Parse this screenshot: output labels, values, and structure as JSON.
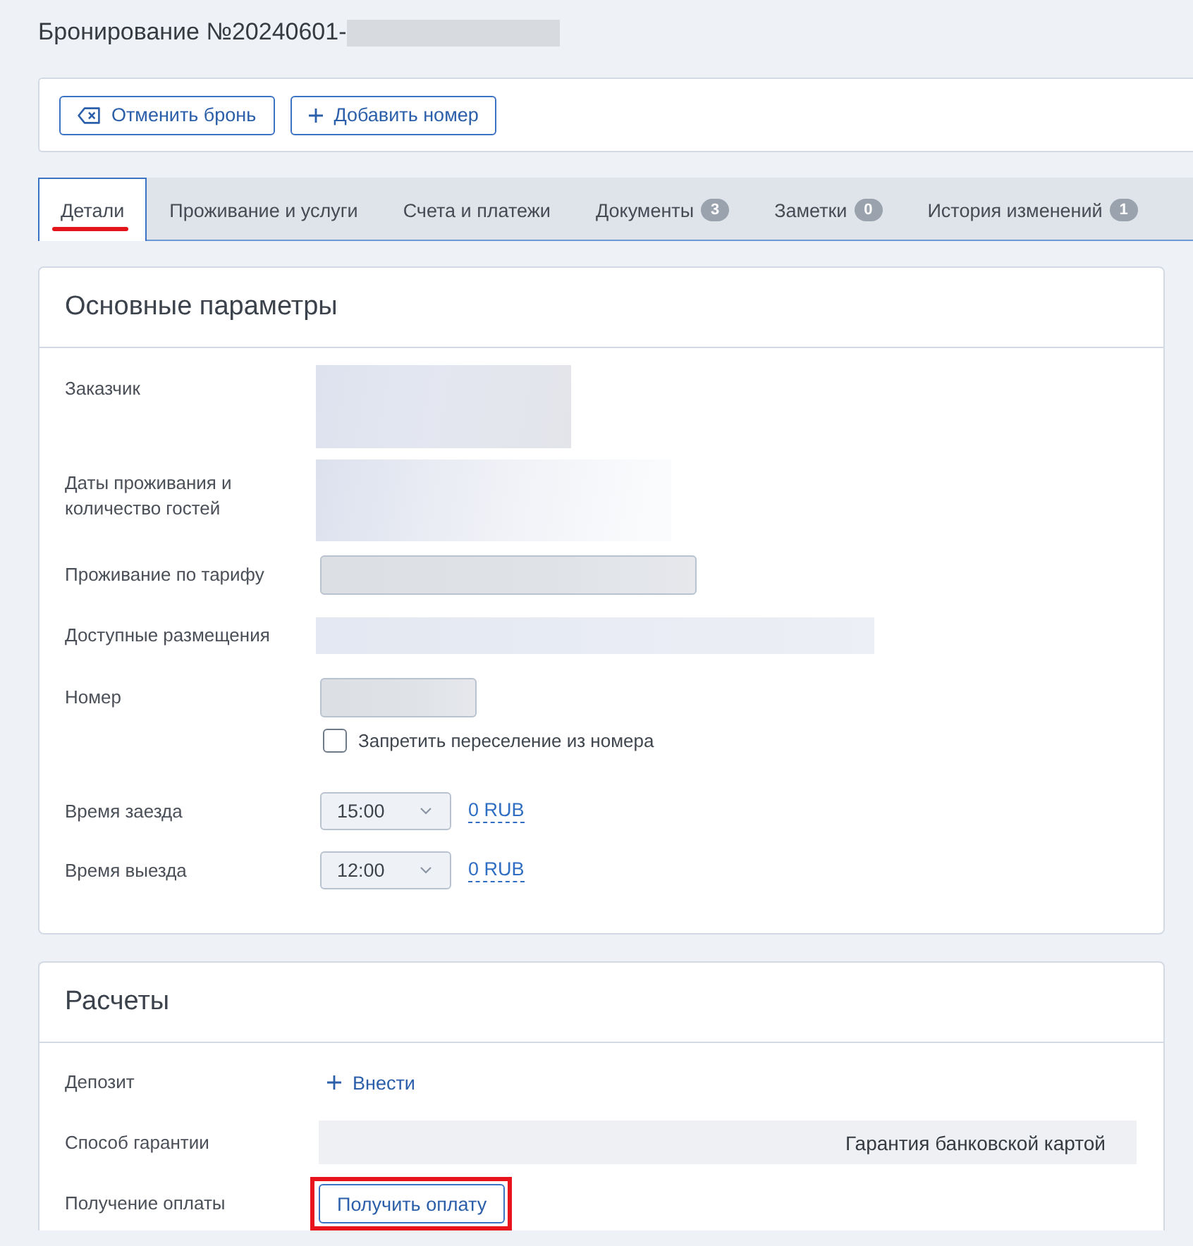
{
  "header": {
    "title": "Бронирование №20240601-",
    "number_redacted": true
  },
  "actions": [
    {
      "kind": "cancel",
      "label": "Отменить бронь"
    },
    {
      "kind": "add",
      "label": "Добавить номер"
    }
  ],
  "tabs": [
    {
      "label": "Детали",
      "selected": true
    },
    {
      "label": "Проживание и услуги",
      "selected": false
    },
    {
      "label": "Счета и платежи",
      "selected": false
    },
    {
      "label": "Документы",
      "badge": "3",
      "selected": false
    },
    {
      "label": "Заметки",
      "badge": "0",
      "selected": false
    },
    {
      "label": "История изменений",
      "badge": "1",
      "selected": false
    }
  ],
  "sections": [
    {
      "title": "Основные параметры",
      "rows": [
        {
          "kind": "redacted_block",
          "label": "Заказчик"
        },
        {
          "kind": "redacted_block",
          "label": "Даты проживания и количество гостей"
        },
        {
          "kind": "redacted_input",
          "label": "Проживание по тарифу"
        },
        {
          "kind": "redacted_strip",
          "label": "Доступные размещения"
        },
        {
          "kind": "redacted_input",
          "label": "Номер",
          "checkbox": {
            "label": "Запретить переселение из номера",
            "checked": false
          }
        },
        {
          "kind": "select",
          "label": "Время заезда",
          "value": "15:00",
          "price": "0 RUB"
        },
        {
          "kind": "select",
          "label": "Время выезда",
          "value": "12:00",
          "price": "0 RUB"
        }
      ]
    },
    {
      "title": "Расчеты",
      "rows": [
        {
          "kind": "add_link",
          "label": "Депозит",
          "link": "Внести"
        },
        {
          "kind": "readonly",
          "label": "Способ гарантии",
          "value": "Гарантия банковской картой"
        },
        {
          "kind": "button",
          "label": "Получение оплаты",
          "button": "Получить оплату",
          "highlighted": true
        }
      ]
    }
  ]
}
